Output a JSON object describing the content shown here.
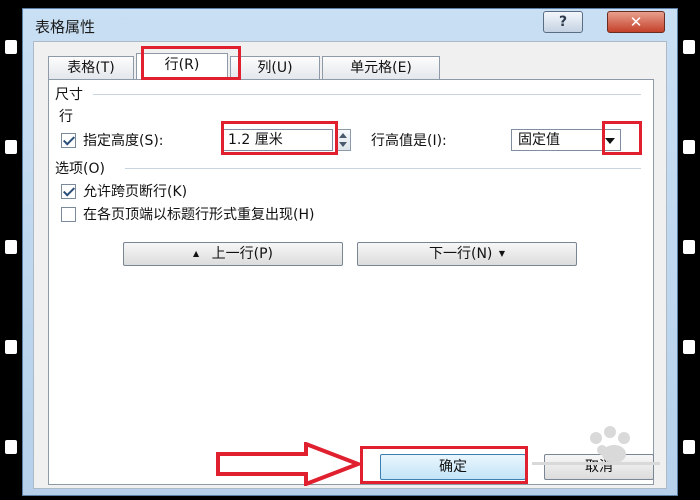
{
  "window": {
    "title": "表格属性",
    "help_label": "?",
    "close_label": "✕"
  },
  "tabs": [
    {
      "label": "表格(T)"
    },
    {
      "label": "行(R)"
    },
    {
      "label": "列(U)"
    },
    {
      "label": "单元格(E)"
    }
  ],
  "size": {
    "section_label": "尺寸",
    "row_label": "行",
    "specify_height_label": "指定高度(S):",
    "specify_height_checked": true,
    "height_value": "1.2 厘米",
    "row_height_is_label": "行高值是(I):",
    "row_height_mode": "固定值"
  },
  "options": {
    "section_label": "选项(O)",
    "allow_break_label": "允许跨页断行(K)",
    "allow_break_checked": true,
    "repeat_header_label": "在各页顶端以标题行形式重复出现(H)",
    "repeat_header_checked": false
  },
  "nav": {
    "prev_label": "上一行(P)",
    "next_label": "下一行(N)",
    "prev_arrow": "▲",
    "next_arrow": "▼"
  },
  "footer": {
    "ok_label": "确定",
    "cancel_label": "取消"
  },
  "annotation_color": "#e0202e"
}
